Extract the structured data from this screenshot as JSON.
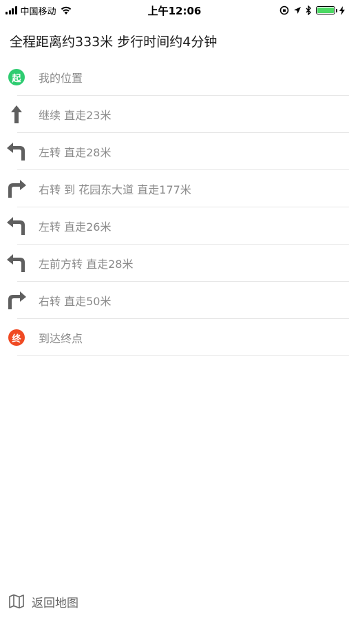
{
  "status_bar": {
    "carrier": "中国移动",
    "time": "上午12:06",
    "icons": [
      "signal-icon",
      "wifi-icon",
      "rotation-lock-icon",
      "location-arrow-icon",
      "bluetooth-icon",
      "battery-icon",
      "charging-icon"
    ],
    "battery_color": "#4cd964"
  },
  "summary": {
    "text": "全程距离约333米 步行时间约4分钟"
  },
  "steps": [
    {
      "icon": "start-badge",
      "badge_text": "起",
      "label": "我的位置"
    },
    {
      "icon": "arrow-up-icon",
      "label": "继续 直走23米"
    },
    {
      "icon": "turn-left-icon",
      "label": "左转 直走28米"
    },
    {
      "icon": "turn-right-icon",
      "label": "右转 到 花园东大道 直走177米"
    },
    {
      "icon": "turn-left-icon",
      "label": "左转 直走26米"
    },
    {
      "icon": "turn-left-icon",
      "label": "左前方转 直走28米"
    },
    {
      "icon": "turn-right-icon",
      "label": "右转 直走50米"
    },
    {
      "icon": "end-badge",
      "badge_text": "终",
      "label": "到达终点"
    }
  ],
  "colors": {
    "start_badge": "#2ecc71",
    "end_badge": "#f04a23",
    "arrow": "#5f5f5f"
  },
  "bottom": {
    "icon": "map-icon",
    "label": "返回地图"
  }
}
